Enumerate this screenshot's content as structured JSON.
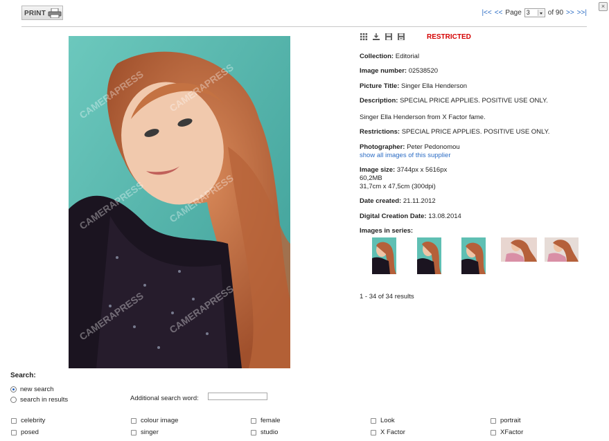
{
  "toolbar": {
    "print_label": "PRINT",
    "close_symbol": "×"
  },
  "pager": {
    "first": "|<<",
    "prev": "<<",
    "page_label": "Page",
    "current": "3",
    "of_label": "of 90",
    "next": ">>",
    "last": ">>|"
  },
  "image": {
    "status": "RESTRICTED",
    "fields": {
      "collection": {
        "label": "Collection:",
        "value": "Editorial"
      },
      "number": {
        "label": "Image number:",
        "value": "02538520"
      },
      "title": {
        "label": "Picture Title:",
        "value": "Singer Ella Henderson"
      },
      "description": {
        "label": "Description:",
        "value": "SPECIAL PRICE APPLIES. POSITIVE USE ONLY."
      },
      "caption": "Singer Ella Henderson from X Factor fame.",
      "restrictions": {
        "label": "Restrictions:",
        "value": "SPECIAL PRICE APPLIES. POSITIVE USE ONLY."
      },
      "photographer": {
        "label": "Photographer:",
        "value": "Peter Pedonomou",
        "link": "show all images of this supplier"
      },
      "size": {
        "label": "Image size:",
        "value": "3744px x 5616px",
        "mb": "60,2MB",
        "cm": "31,7cm x 47,5cm (300dpi)"
      },
      "date_created": {
        "label": "Date created:",
        "value": "21.11.2012"
      },
      "digital_date": {
        "label": "Digital Creation Date:",
        "value": "13.08.2014"
      },
      "series_label": "Images in series:"
    },
    "watermark": "CAMERAPRESS",
    "results": "1 - 34 of 34 results"
  },
  "tool_icons": [
    "grid-icon",
    "download-icon",
    "save-icon",
    "save-as-icon"
  ],
  "search": {
    "title": "Search:",
    "new_search": "new search",
    "in_results": "search in results",
    "additional_label": "Additional search word:",
    "additional_value": "",
    "keywords_row1": [
      "celebrity",
      "colour image",
      "female",
      "Look",
      "portrait"
    ],
    "keywords_row2": [
      "posed",
      "singer",
      "studio",
      "X Factor",
      "XFactor"
    ]
  },
  "colors": {
    "link": "#2b6cc4",
    "restricted": "#d40000",
    "photo_bg": "#5fbfb3"
  }
}
